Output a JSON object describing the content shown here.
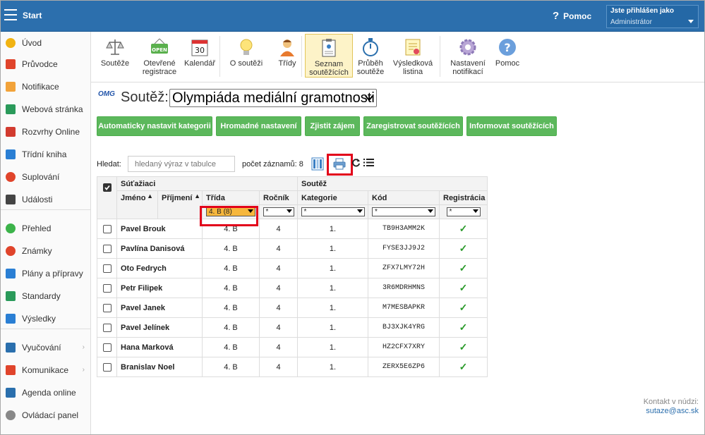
{
  "header": {
    "app_title": "Start",
    "help_label": "Pomoc",
    "user_line1": "Jste přihlášen jako",
    "user_line2": "Administrátor"
  },
  "sidebar": {
    "items": [
      {
        "label": "Úvod",
        "color": "#f1b312",
        "icon": "star-icon"
      },
      {
        "label": "Průvodce",
        "color": "#e0442b",
        "icon": "wand-icon"
      },
      {
        "label": "Notifikace",
        "color": "#f2a33a",
        "icon": "envelope-icon"
      },
      {
        "label": "Webová stránka",
        "color": "#2a9a5a",
        "icon": "home-icon"
      },
      {
        "label": "Rozvrhy Online",
        "color": "#d23b2f",
        "icon": "timetable-icon"
      },
      {
        "label": "Třídní kniha",
        "color": "#2a7fd4",
        "icon": "book-icon"
      },
      {
        "label": "Suplování",
        "color": "#e0442b",
        "icon": "substitution-icon"
      },
      {
        "label": "Události",
        "color": "#444444",
        "icon": "calendar-icon"
      },
      {
        "label": "Přehled",
        "color": "#3cb34a",
        "icon": "check-circle-icon"
      },
      {
        "label": "Známky",
        "color": "#e0442b",
        "icon": "grade-icon"
      },
      {
        "label": "Plány a přípravy",
        "color": "#2a7fd4",
        "icon": "briefcase-icon"
      },
      {
        "label": "Standardy",
        "color": "#2a9a5a",
        "icon": "shield-icon"
      },
      {
        "label": "Výsledky",
        "color": "#2a7fd4",
        "icon": "bar-chart-icon"
      },
      {
        "label": "Vyučování",
        "color": "#2a6fad",
        "icon": "open-book-icon"
      },
      {
        "label": "Komunikace",
        "color": "#e0442b",
        "icon": "chat-icon"
      },
      {
        "label": "Agenda online",
        "color": "#2a6fad",
        "icon": "pen-icon"
      },
      {
        "label": "Ovládací panel",
        "color": "#888888",
        "icon": "gear-icon"
      }
    ]
  },
  "toolbar": {
    "items": [
      {
        "label": "Soutěže",
        "icon": "scales-icon"
      },
      {
        "label": "Otevřené registrace",
        "icon": "open-sign-icon",
        "badge": "OPEN"
      },
      {
        "label": "Kalendář",
        "icon": "calendar-day-icon",
        "badge": "30"
      },
      {
        "label": "O soutěži",
        "icon": "lightbulb-icon"
      },
      {
        "label": "Třídy",
        "icon": "student-icon"
      },
      {
        "label": "Seznam soutěžících",
        "icon": "clipboard-icon"
      },
      {
        "label": "Průběh soutěže",
        "icon": "stopwatch-icon"
      },
      {
        "label": "Výsledková listina",
        "icon": "certificate-icon"
      },
      {
        "label": "Nastavení notifikací",
        "icon": "gear-icon"
      },
      {
        "label": "Pomoc",
        "icon": "help-icon"
      }
    ]
  },
  "competition": {
    "logo": "OMG",
    "label": "Soutěž:",
    "selected": "Olympiáda mediální gramotnosti"
  },
  "actions": {
    "auto_category": "Automaticky nastavit kategorii",
    "bulk_settings": "Hromadné nastavení",
    "find_interest": "Zjistit zájem",
    "register": "Zaregistrovat soutěžících",
    "inform": "Informovat soutěžících"
  },
  "search": {
    "label": "Hledat:",
    "placeholder": "hledaný výraz v tabulce",
    "count_label": "počet záznamů: 8"
  },
  "table": {
    "group_students": "Súťažiaci",
    "group_competition": "Soutěž",
    "columns": {
      "first": "Jméno",
      "last": "Příjmení",
      "class": "Třída",
      "year": "Ročník",
      "category": "Kategorie",
      "code": "Kód",
      "registration": "Registrácia"
    },
    "filters": {
      "class": "4. B (8)",
      "year": "*",
      "category": "*",
      "code": "*",
      "registration": "*"
    },
    "rows": [
      {
        "name": "Pavel Brouk",
        "class": "4. B",
        "year": "4",
        "category": "1.",
        "code": "TB9H3AMM2K",
        "registered": "✓"
      },
      {
        "name": "Pavlína Danisová",
        "class": "4. B",
        "year": "4",
        "category": "1.",
        "code": "FYSE3JJ9J2",
        "registered": "✓"
      },
      {
        "name": "Oto Fedrych",
        "class": "4. B",
        "year": "4",
        "category": "1.",
        "code": "ZFX7LMY72H",
        "registered": "✓"
      },
      {
        "name": "Petr Filipek",
        "class": "4. B",
        "year": "4",
        "category": "1.",
        "code": "3R6MDRHMNS",
        "registered": "✓"
      },
      {
        "name": "Pavel Janek",
        "class": "4. B",
        "year": "4",
        "category": "1.",
        "code": "M7MESBAPKR",
        "registered": "✓"
      },
      {
        "name": "Pavel Jelínek",
        "class": "4. B",
        "year": "4",
        "category": "1.",
        "code": "BJ3XJK4YRG",
        "registered": "✓"
      },
      {
        "name": "Hana Marková",
        "class": "4. B",
        "year": "4",
        "category": "1.",
        "code": "HZ2CFX7XRY",
        "registered": "✓"
      },
      {
        "name": "Branislav Noel",
        "class": "4. B",
        "year": "4",
        "category": "1.",
        "code": "ZERX5E6ZP6",
        "registered": "✓"
      }
    ]
  },
  "contact": {
    "label": "Kontakt v núdzi:",
    "email": "sutaze@asc.sk"
  }
}
